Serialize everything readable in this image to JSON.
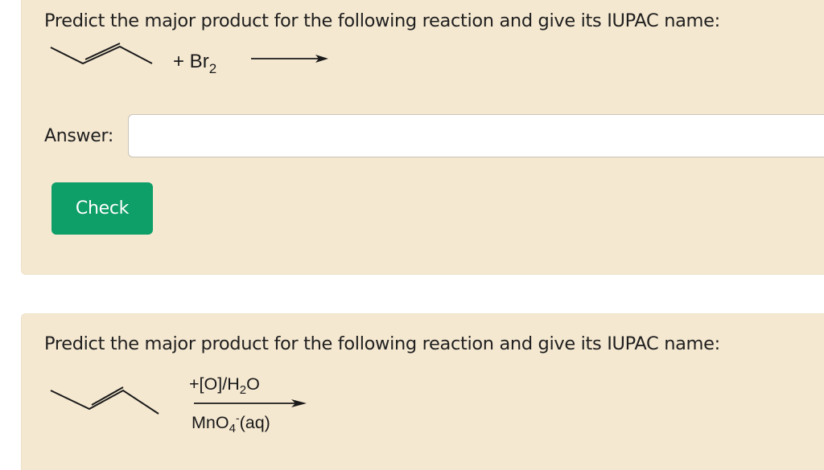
{
  "problem1": {
    "question": "Predict the major product for the following reaction and give its IUPAC name:",
    "molecule_icon": "but-2-ene-skeletal-structure",
    "reagent_prefix": "+ Br",
    "reagent_subscript": "2",
    "answer_label": "Answer:",
    "answer_value": "",
    "check_label": "Check",
    "check_color": "#0e9e68"
  },
  "problem2": {
    "question": "Predict the major product for the following reaction and give its IUPAC name:",
    "molecule_icon": "but-2-ene-skeletal-structure",
    "condition_top": {
      "prefix": "+[O]/H",
      "subscript": "2",
      "suffix": "O"
    },
    "condition_bottom": {
      "prefix": "MnO",
      "subscript": "4",
      "superscript": "-",
      "suffix": "(aq)"
    }
  },
  "colors": {
    "card_background": "#f5e8d1",
    "button_green": "#0e9e68"
  }
}
